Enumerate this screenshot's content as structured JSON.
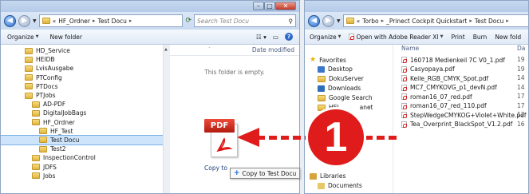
{
  "left_window": {
    "breadcrumb": [
      "«",
      "HF_Ordner",
      "Test Docu"
    ],
    "search_placeholder": "Search Test Docu",
    "toolbar": {
      "organize": "Organize",
      "new_folder": "New folder"
    },
    "column_header": "Date modified",
    "empty_message": "This folder is empty.",
    "tree": [
      {
        "label": "HD_Service",
        "indent": 0
      },
      {
        "label": "HEIDB",
        "indent": 0
      },
      {
        "label": "LvisAusgabe",
        "indent": 0
      },
      {
        "label": "PTConfig",
        "indent": 0
      },
      {
        "label": "PTDocs",
        "indent": 0
      },
      {
        "label": "PTJobs",
        "indent": 0
      },
      {
        "label": "AD-PDF",
        "indent": 1
      },
      {
        "label": "DigitalJobBags",
        "indent": 1
      },
      {
        "label": "HF_Ordner",
        "indent": 1
      },
      {
        "label": "HF_Test",
        "indent": 2
      },
      {
        "label": "Test Docu",
        "indent": 2,
        "selected": true
      },
      {
        "label": "Test2",
        "indent": 2
      },
      {
        "label": "InspectionControl",
        "indent": 1
      },
      {
        "label": "JDFS",
        "indent": 1
      },
      {
        "label": "Jobs",
        "indent": 1
      }
    ],
    "drag": {
      "pdf_label": "PDF",
      "copy_ghost": "Copy to",
      "copy_tip": "Copy to Test Docu",
      "plus": "+"
    }
  },
  "right_window": {
    "breadcrumb": [
      "«",
      "Torbo",
      "_Prinect Cockpit Quickstart",
      "Test Docu"
    ],
    "toolbar": {
      "organize": "Organize",
      "open_with": "Open with Adobe Reader XI",
      "print": "Print",
      "burn": "Burn",
      "new_folder": "New fold"
    },
    "column_name": "Name",
    "column_date_cut": "Da",
    "favorites_header": "Favorites",
    "favorites": [
      "Desktop",
      "DokuServer",
      "Downloads",
      "Google Search",
      "HEI"
    ],
    "favorites_partial": "anet",
    "libraries_header": "Libraries",
    "libraries": [
      "Documents"
    ],
    "files": [
      {
        "name": "160718 Medienkeil 7C V0_1.pdf",
        "date": "19"
      },
      {
        "name": "Casyopaya.pdf",
        "date": "19"
      },
      {
        "name": "Keile_RGB_CMYK_Spot.pdf",
        "date": "14"
      },
      {
        "name": "MC7_CMYKOVG_p1_devN.pdf",
        "date": "14"
      },
      {
        "name": "roman16_07_red.pdf",
        "date": "17"
      },
      {
        "name": "roman16_07_red_110.pdf",
        "date": "17"
      },
      {
        "name": "StepWedgeCMYKOG+Violet+White.pdf",
        "date": "12"
      },
      {
        "name": "Tea_Overprint_BlackSpot_V1.2.pdf",
        "date": "16"
      }
    ]
  },
  "callout": {
    "number": "1"
  },
  "colors": {
    "accent_red": "#e01b1b",
    "selection": "#cde4fb",
    "chrome": "#c9daf0"
  }
}
